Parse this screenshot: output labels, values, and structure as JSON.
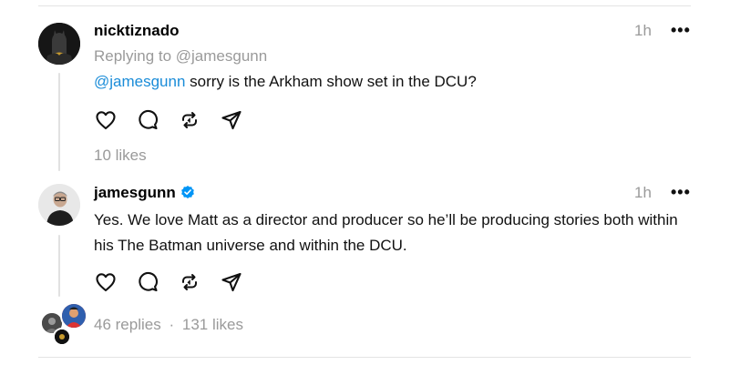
{
  "post1": {
    "username": "nicktiznado",
    "time": "1h",
    "more": "•••",
    "reply_to": "Replying to @jamesgunn",
    "mention": "@jamesgunn",
    "text": " sorry is the Arkham show set in the DCU?",
    "likes": "10 likes"
  },
  "post2": {
    "username": "jamesgunn",
    "verified_icon": "verified-badge-icon",
    "time": "1h",
    "more": "•••",
    "text": "Yes. We love Matt as a director and producer so he’ll be producing stories both within his The Batman universe and within the DCU.",
    "replies": "46 replies",
    "separator": "·",
    "likes": "131 likes"
  },
  "icons": {
    "like": "heart-icon",
    "comment": "comment-icon",
    "repost": "repost-icon",
    "share": "send-icon"
  },
  "colors": {
    "mention": "#1a8cd8",
    "muted": "#9a9a9a",
    "verified": "#0095f6"
  }
}
